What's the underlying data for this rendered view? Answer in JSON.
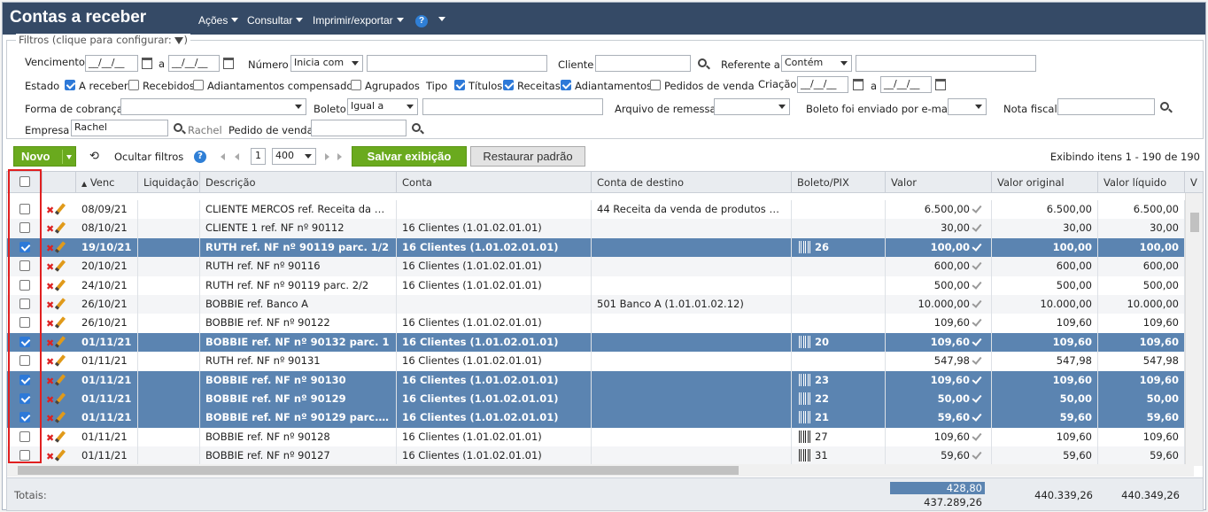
{
  "header": {
    "title": "Contas a receber",
    "menu": [
      "Ações",
      "Consultar",
      "Imprimir/exportar"
    ],
    "help_glyph": "?"
  },
  "filters": {
    "legend": "Filtros (clique para configurar:",
    "vencimento": {
      "label": "Vencimento",
      "from": "__/__/__",
      "sep": "a",
      "to": "__/__/__"
    },
    "numero": {
      "label": "Número",
      "mode": "Inicia com",
      "value": ""
    },
    "cliente": {
      "label": "Cliente",
      "value": ""
    },
    "referente": {
      "label": "Referente a",
      "mode": "Contém",
      "value": ""
    },
    "estado": {
      "label": "Estado",
      "options": [
        {
          "label": "A receber",
          "checked": true
        },
        {
          "label": "Recebidos",
          "checked": false
        },
        {
          "label": "Adiantamentos compensados",
          "checked": false
        },
        {
          "label": "Agrupados",
          "checked": false
        }
      ]
    },
    "tipo": {
      "label": "Tipo",
      "options": [
        {
          "label": "Títulos",
          "checked": true
        },
        {
          "label": "Receitas",
          "checked": true
        },
        {
          "label": "Adiantamentos",
          "checked": true
        },
        {
          "label": "Pedidos de venda",
          "checked": false
        }
      ]
    },
    "criacao": {
      "label": "Criação",
      "from": "__/__/__",
      "sep": "a",
      "to": "__/__/__"
    },
    "forma_cobranca": {
      "label": "Forma de cobrança",
      "value": ""
    },
    "boleto": {
      "label": "Boleto",
      "mode": "Igual a",
      "value": ""
    },
    "arquivo_remessa": {
      "label": "Arquivo de remessa",
      "value": ""
    },
    "boleto_email": {
      "label": "Boleto foi enviado por e-mail",
      "value": ""
    },
    "nota_fiscal": {
      "label": "Nota fiscal",
      "value": ""
    },
    "empresa": {
      "label": "Empresa",
      "value": "Rachel",
      "hint": "Rachel"
    },
    "pedido_venda": {
      "label": "Pedido de venda",
      "value": ""
    }
  },
  "toolbar": {
    "novo": "Novo",
    "ocultar": "Ocultar filtros",
    "page": "1",
    "page_size": "400",
    "salvar": "Salvar exibição",
    "restaurar": "Restaurar padrão",
    "status": "Exibindo itens 1 - 190 de 190"
  },
  "columns": [
    "Venc",
    "Liquidação",
    "Descrição",
    "Conta",
    "Conta de destino",
    "Boleto/PIX",
    "Valor",
    "Valor original",
    "Valor líquido",
    "V"
  ],
  "rows": [
    {
      "sel": false,
      "venc": "08/09/21",
      "liq": "",
      "desc": "CLIENTE MERCOS ref. Receita da ve...",
      "conta": "",
      "destino": "44 Receita da venda de produtos de f...",
      "boleto": "",
      "btype": "",
      "valor": "6.500,00",
      "orig": "6.500,00",
      "liqv": "6.500,00"
    },
    {
      "sel": false,
      "venc": "08/10/21",
      "liq": "",
      "desc": "CLIENTE 1 ref. NF nº 90112",
      "conta": "16 Clientes (1.01.02.01.01)",
      "destino": "",
      "boleto": "",
      "btype": "",
      "valor": "30,00",
      "orig": "30,00",
      "liqv": "30,00"
    },
    {
      "sel": true,
      "venc": "19/10/21",
      "liq": "",
      "desc": "RUTH ref. NF nº 90119 parc. 1/2",
      "conta": "16 Clientes (1.01.02.01.01)",
      "destino": "",
      "boleto": "26",
      "btype": "y",
      "valor": "100,00",
      "orig": "100,00",
      "liqv": "100,00"
    },
    {
      "sel": false,
      "venc": "20/10/21",
      "liq": "",
      "desc": "RUTH ref. NF nº 90116",
      "conta": "16 Clientes (1.01.02.01.01)",
      "destino": "",
      "boleto": "",
      "btype": "",
      "valor": "600,00",
      "orig": "600,00",
      "liqv": "600,00"
    },
    {
      "sel": false,
      "venc": "24/10/21",
      "liq": "",
      "desc": "RUTH ref. NF nº 90119 parc. 2/2",
      "conta": "16 Clientes (1.01.02.01.01)",
      "destino": "",
      "boleto": "",
      "btype": "",
      "valor": "500,00",
      "orig": "500,00",
      "liqv": "500,00"
    },
    {
      "sel": false,
      "venc": "26/10/21",
      "liq": "",
      "desc": "BOBBIE ref. Banco A",
      "conta": "",
      "destino": "501 Banco A (1.01.01.02.12)",
      "boleto": "",
      "btype": "",
      "valor": "10.000,00",
      "orig": "10.000,00",
      "liqv": "10.000,00"
    },
    {
      "sel": false,
      "venc": "26/10/21",
      "liq": "",
      "desc": "BOBBIE ref. NF nº 90122",
      "conta": "16 Clientes (1.01.02.01.01)",
      "destino": "",
      "boleto": "",
      "btype": "",
      "valor": "109,60",
      "orig": "109,60",
      "liqv": "109,60"
    },
    {
      "sel": true,
      "venc": "01/11/21",
      "liq": "",
      "desc": "BOBBIE ref. NF nº 90132 parc. 1",
      "conta": "16 Clientes (1.01.02.01.01)",
      "destino": "",
      "boleto": "20",
      "btype": "g",
      "valor": "109,60",
      "orig": "109,60",
      "liqv": "109,60"
    },
    {
      "sel": false,
      "venc": "01/11/21",
      "liq": "",
      "desc": "RUTH ref. NF nº 90131",
      "conta": "16 Clientes (1.01.02.01.01)",
      "destino": "",
      "boleto": "",
      "btype": "",
      "valor": "547,98",
      "orig": "547,98",
      "liqv": "547,98"
    },
    {
      "sel": true,
      "venc": "01/11/21",
      "liq": "",
      "desc": "BOBBIE ref. NF nº 90130",
      "conta": "16 Clientes (1.01.02.01.01)",
      "destino": "",
      "boleto": "23",
      "btype": "b",
      "valor": "109,60",
      "orig": "109,60",
      "liqv": "109,60"
    },
    {
      "sel": true,
      "venc": "01/11/21",
      "liq": "",
      "desc": "BOBBIE ref. NF nº 90129",
      "conta": "16 Clientes (1.01.02.01.01)",
      "destino": "",
      "boleto": "22",
      "btype": "b",
      "valor": "50,00",
      "orig": "50,00",
      "liqv": "50,00"
    },
    {
      "sel": true,
      "venc": "01/11/21",
      "liq": "",
      "desc": "BOBBIE ref. NF nº 90129 parc. 2/2",
      "conta": "16 Clientes (1.01.02.01.01)",
      "destino": "",
      "boleto": "21",
      "btype": "b",
      "valor": "59,60",
      "orig": "59,60",
      "liqv": "59,60"
    },
    {
      "sel": false,
      "venc": "01/11/21",
      "liq": "",
      "desc": "BOBBIE ref. NF nº 90128",
      "conta": "16 Clientes (1.01.02.01.01)",
      "destino": "",
      "boleto": "27",
      "btype": "b",
      "valor": "109,60",
      "orig": "109,60",
      "liqv": "109,60"
    },
    {
      "sel": false,
      "venc": "01/11/21",
      "liq": "",
      "desc": "BOBBIE ref. NF nº 90127",
      "conta": "16 Clientes (1.01.02.01.01)",
      "destino": "",
      "boleto": "31",
      "btype": "b",
      "valor": "59,60",
      "orig": "59,60",
      "liqv": "59,60"
    }
  ],
  "totals": {
    "label": "Totais:",
    "selected_valor": "428,80",
    "valor": "437.289,26",
    "orig": "440.339,26",
    "liq": "440.349,26"
  },
  "colors": {
    "header_bg": "#354a66",
    "selected_row": "#5b84b1",
    "green_button": "#6aaa1e",
    "highlight_box": "#e02020"
  }
}
